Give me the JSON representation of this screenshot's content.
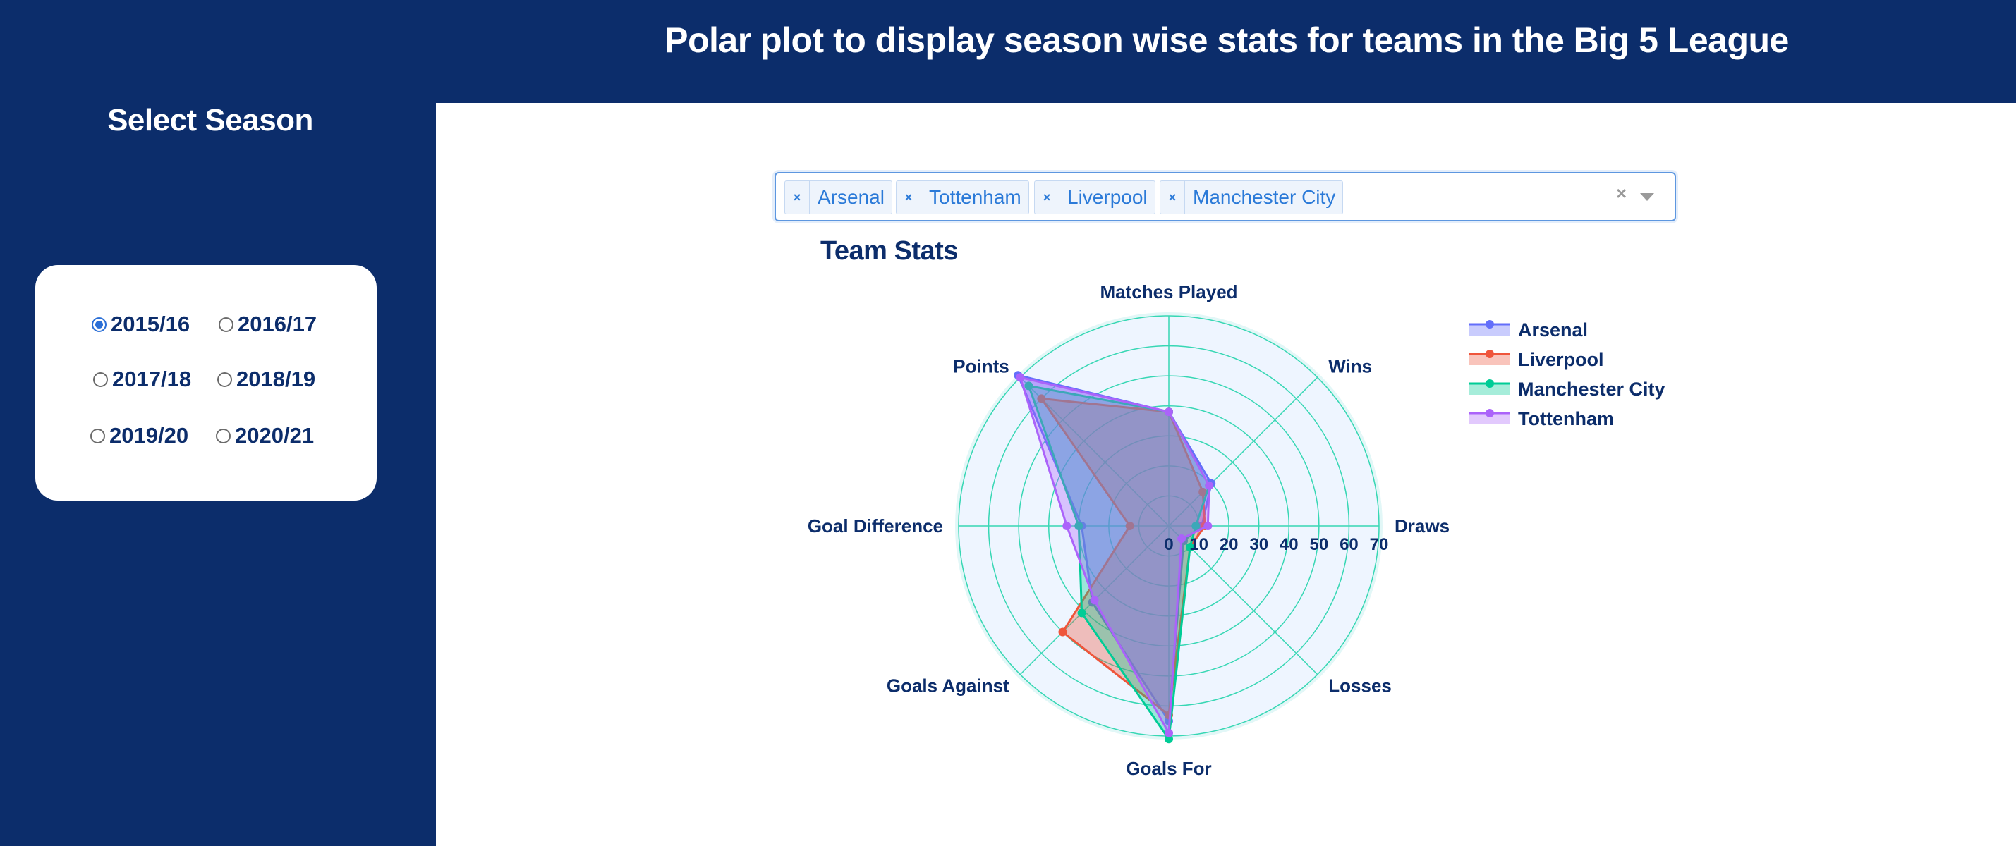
{
  "header": {
    "title": "Polar plot to display season wise stats for teams in the Big 5 League"
  },
  "sidebar": {
    "title": "Select Season",
    "seasons": [
      {
        "label": "2015/16",
        "checked": true
      },
      {
        "label": "2016/17",
        "checked": false
      },
      {
        "label": "2017/18",
        "checked": false
      },
      {
        "label": "2018/19",
        "checked": false
      },
      {
        "label": "2019/20",
        "checked": false
      },
      {
        "label": "2020/21",
        "checked": false
      }
    ]
  },
  "team_select": {
    "tags": [
      "Arsenal",
      "Tottenham",
      "Liverpool",
      "Manchester City"
    ],
    "remove_glyph": "×",
    "clear_glyph": "×"
  },
  "chart_data": {
    "type": "polar",
    "title": "Team Stats",
    "theta": [
      "Matches Played",
      "Wins",
      "Draws",
      "Losses",
      "Goals For",
      "Goals Against",
      "Goal  Difference",
      "Points"
    ],
    "radial_range": [
      0,
      70
    ],
    "radial_ticks": [
      "0",
      "10",
      "20",
      "30",
      "40",
      "50",
      "60",
      "70"
    ],
    "legend_position": "top-right",
    "series": [
      {
        "name": "Arsenal",
        "color": "#636efa",
        "values": [
          38,
          20,
          11,
          7,
          65,
          36,
          29,
          71
        ]
      },
      {
        "name": "Liverpool",
        "color": "#ef553b",
        "values": [
          38,
          16,
          12,
          10,
          63,
          50,
          13,
          60
        ]
      },
      {
        "name": "Manchester City",
        "color": "#00cc96",
        "values": [
          38,
          19,
          9,
          10,
          71,
          41,
          30,
          66
        ]
      },
      {
        "name": "Tottenham",
        "color": "#ab63fa",
        "values": [
          38,
          19,
          13,
          6,
          69,
          35,
          34,
          70
        ]
      }
    ]
  },
  "colors": {
    "background": "#0c2d6b",
    "polar_background": "#eef5ff",
    "grid": "#37d7b4"
  }
}
